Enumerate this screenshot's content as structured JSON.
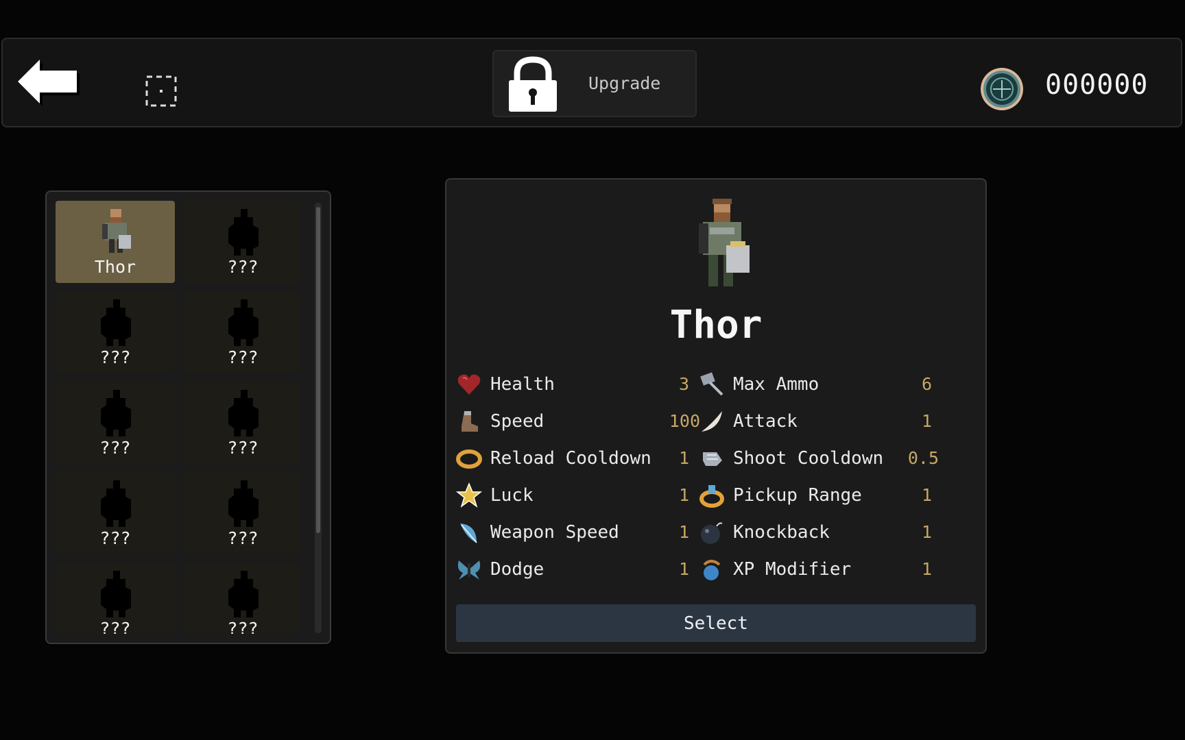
{
  "topbar": {
    "upgrade_label": "Upgrade",
    "currency_value": "000000"
  },
  "character_list": {
    "items": [
      {
        "label": "Thor",
        "selected": true
      },
      {
        "label": "???",
        "selected": false
      },
      {
        "label": "???",
        "selected": false
      },
      {
        "label": "???",
        "selected": false
      },
      {
        "label": "???",
        "selected": false
      },
      {
        "label": "???",
        "selected": false
      },
      {
        "label": "???",
        "selected": false
      },
      {
        "label": "???",
        "selected": false
      },
      {
        "label": "???",
        "selected": false
      },
      {
        "label": "???",
        "selected": false
      }
    ]
  },
  "detail": {
    "name": "Thor",
    "stats_left": [
      {
        "label": "Health",
        "value": "3",
        "icon": "heart-icon"
      },
      {
        "label": "Speed",
        "value": "100",
        "icon": "boot-icon"
      },
      {
        "label": "Reload Cooldown",
        "value": "1",
        "icon": "ring-icon"
      },
      {
        "label": "Luck",
        "value": "1",
        "icon": "star-icon"
      },
      {
        "label": "Weapon Speed",
        "value": "1",
        "icon": "feather-icon"
      },
      {
        "label": "Dodge",
        "value": "1",
        "icon": "butterfly-icon"
      }
    ],
    "stats_right": [
      {
        "label": "Max Ammo",
        "value": "6",
        "icon": "hammer-icon"
      },
      {
        "label": "Attack",
        "value": "1",
        "icon": "fang-icon"
      },
      {
        "label": "Shoot Cooldown",
        "value": "0.5",
        "icon": "gauntlet-icon"
      },
      {
        "label": "Pickup Range",
        "value": "1",
        "icon": "magnet-ring-icon"
      },
      {
        "label": "Knockback",
        "value": "1",
        "icon": "bomb-icon"
      },
      {
        "label": "XP Modifier",
        "value": "1",
        "icon": "potion-icon"
      }
    ],
    "select_label": "Select"
  },
  "colors": {
    "selected_cell": "#6b5f44",
    "stat_value": "#c7a865",
    "select_button": "#2c3643"
  }
}
